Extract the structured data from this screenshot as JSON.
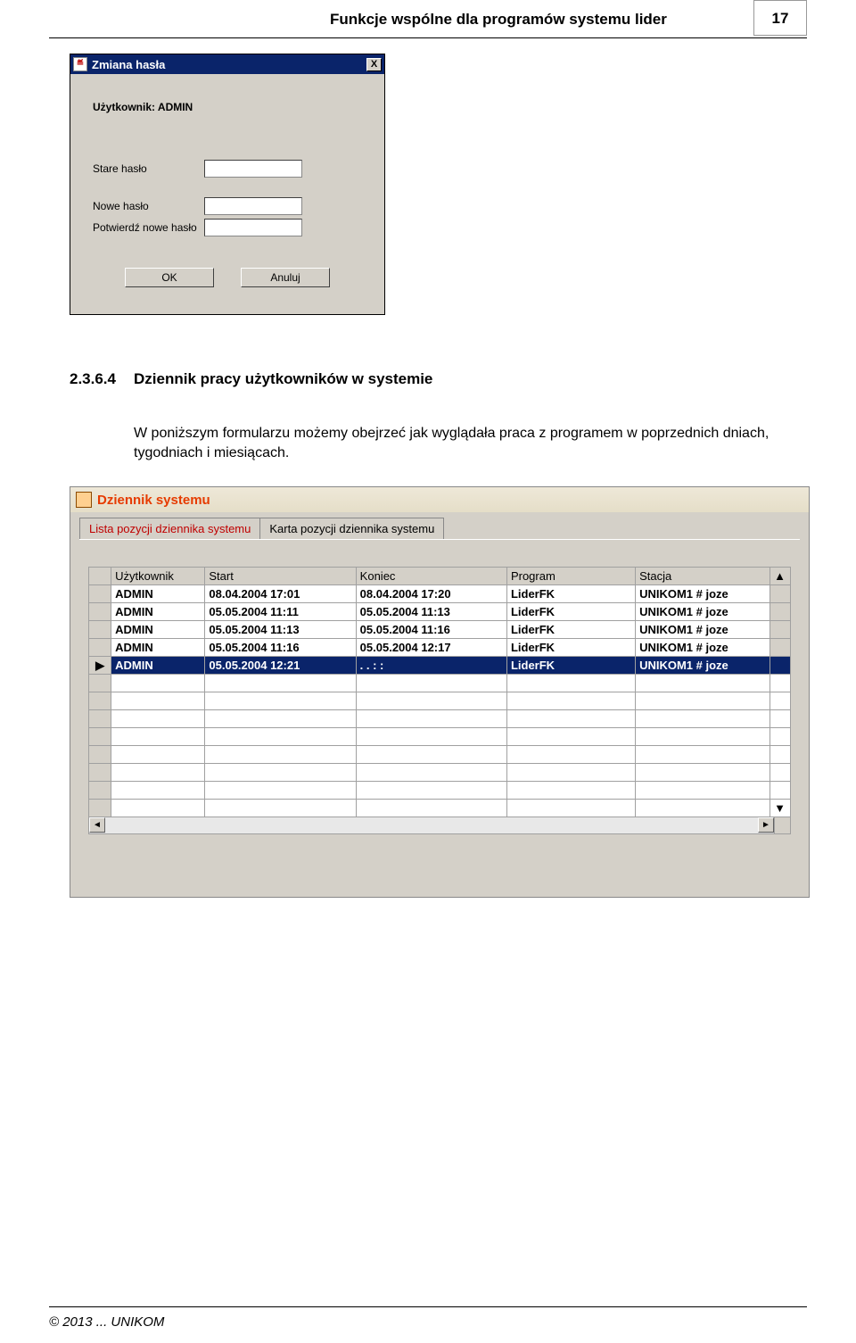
{
  "header": {
    "title": "Funkcje wspólne dla programów systemu lider",
    "page_number": "17"
  },
  "dialog": {
    "titlebar": "Zmiana hasła",
    "java_icon_glyph": "≝",
    "close_glyph": "X",
    "user_label": "Użytkownik: ADMIN",
    "fields": {
      "old_label": "Stare hasło",
      "new_label": "Nowe hasło",
      "confirm_label": "Potwierdź nowe hasło"
    },
    "buttons": {
      "ok": "OK",
      "cancel": "Anuluj"
    }
  },
  "section": {
    "number": "2.3.6.4",
    "title": "Dziennik pracy użytkowników w systemie",
    "text": "W poniższym formularzu możemy obejrzeć jak wyglądała praca z programem w poprzednich dniach, tygodniach i miesiącach."
  },
  "logwin": {
    "title": "Dziennik systemu",
    "tabs": {
      "active": "Lista pozycji dziennika systemu",
      "inactive": "Karta pozycji dziennika systemu"
    },
    "columns": [
      "Użytkownik",
      "Start",
      "Koniec",
      "Program",
      "Stacja"
    ],
    "rows": [
      {
        "user": "ADMIN",
        "start": "08.04.2004 17:01",
        "end": "08.04.2004 17:20",
        "program": "LiderFK",
        "station": "UNIKOM1 # joze"
      },
      {
        "user": "ADMIN",
        "start": "05.05.2004 11:11",
        "end": "05.05.2004 11:13",
        "program": "LiderFK",
        "station": "UNIKOM1 # joze"
      },
      {
        "user": "ADMIN",
        "start": "05.05.2004 11:13",
        "end": "05.05.2004 11:16",
        "program": "LiderFK",
        "station": "UNIKOM1 # joze"
      },
      {
        "user": "ADMIN",
        "start": "05.05.2004 11:16",
        "end": "05.05.2004 12:17",
        "program": "LiderFK",
        "station": "UNIKOM1 # joze"
      },
      {
        "user": "ADMIN",
        "start": "05.05.2004 12:21",
        "end": ". .       :  :",
        "program": "LiderFK",
        "station": "UNIKOM1 # joze"
      }
    ],
    "selected_marker": "▶",
    "scroll": {
      "left": "◄",
      "right": "►",
      "up": "▲",
      "down": "▼"
    }
  },
  "footer": "© 2013 ... UNIKOM"
}
